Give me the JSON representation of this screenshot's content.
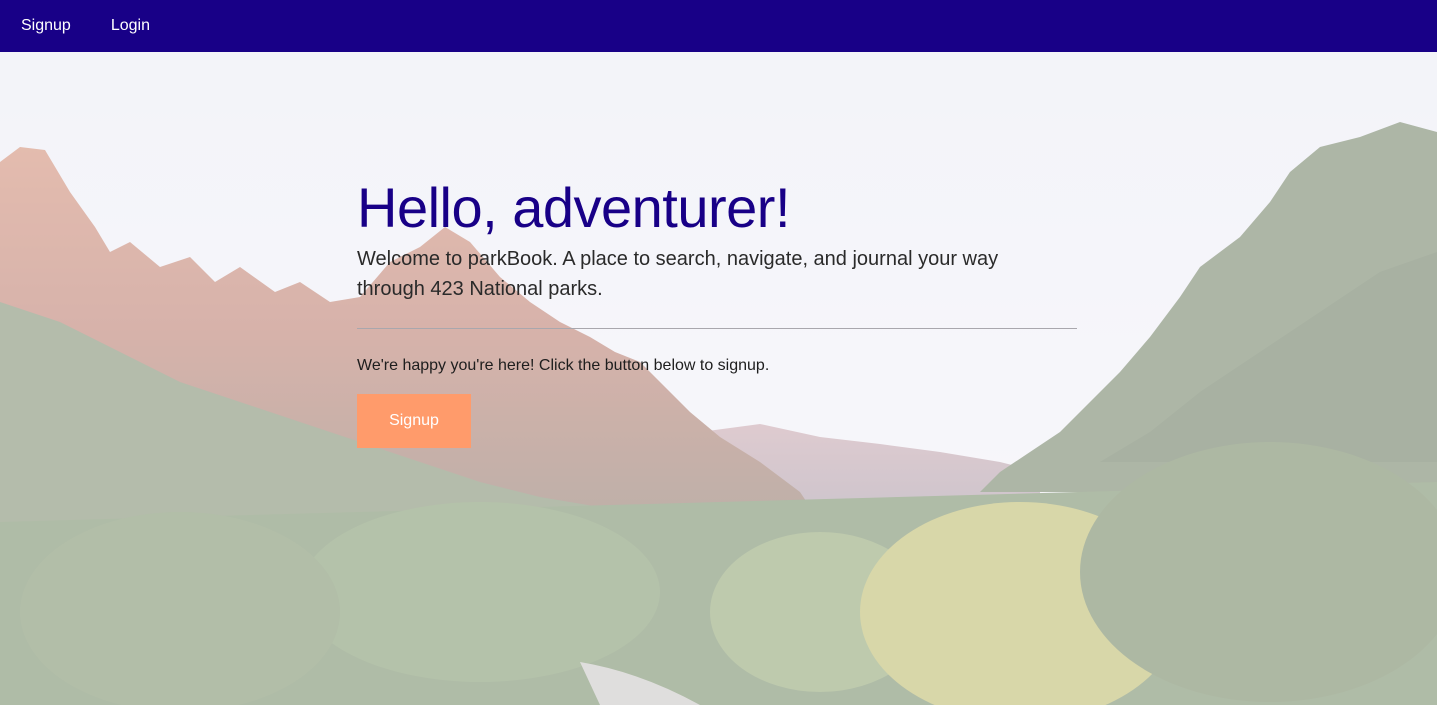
{
  "nav": {
    "links": [
      "Signup",
      "Login"
    ]
  },
  "hero": {
    "title": "Hello, adventurer!",
    "lead": "Welcome to parkBook. A place to search, navigate, and journal your way through 423 National parks.",
    "note": "We're happy you're here! Click the button below to signup.",
    "button_label": "Signup"
  },
  "colors": {
    "nav_bg": "#180087",
    "title": "#180087",
    "button_bg": "#ff9b6b"
  }
}
